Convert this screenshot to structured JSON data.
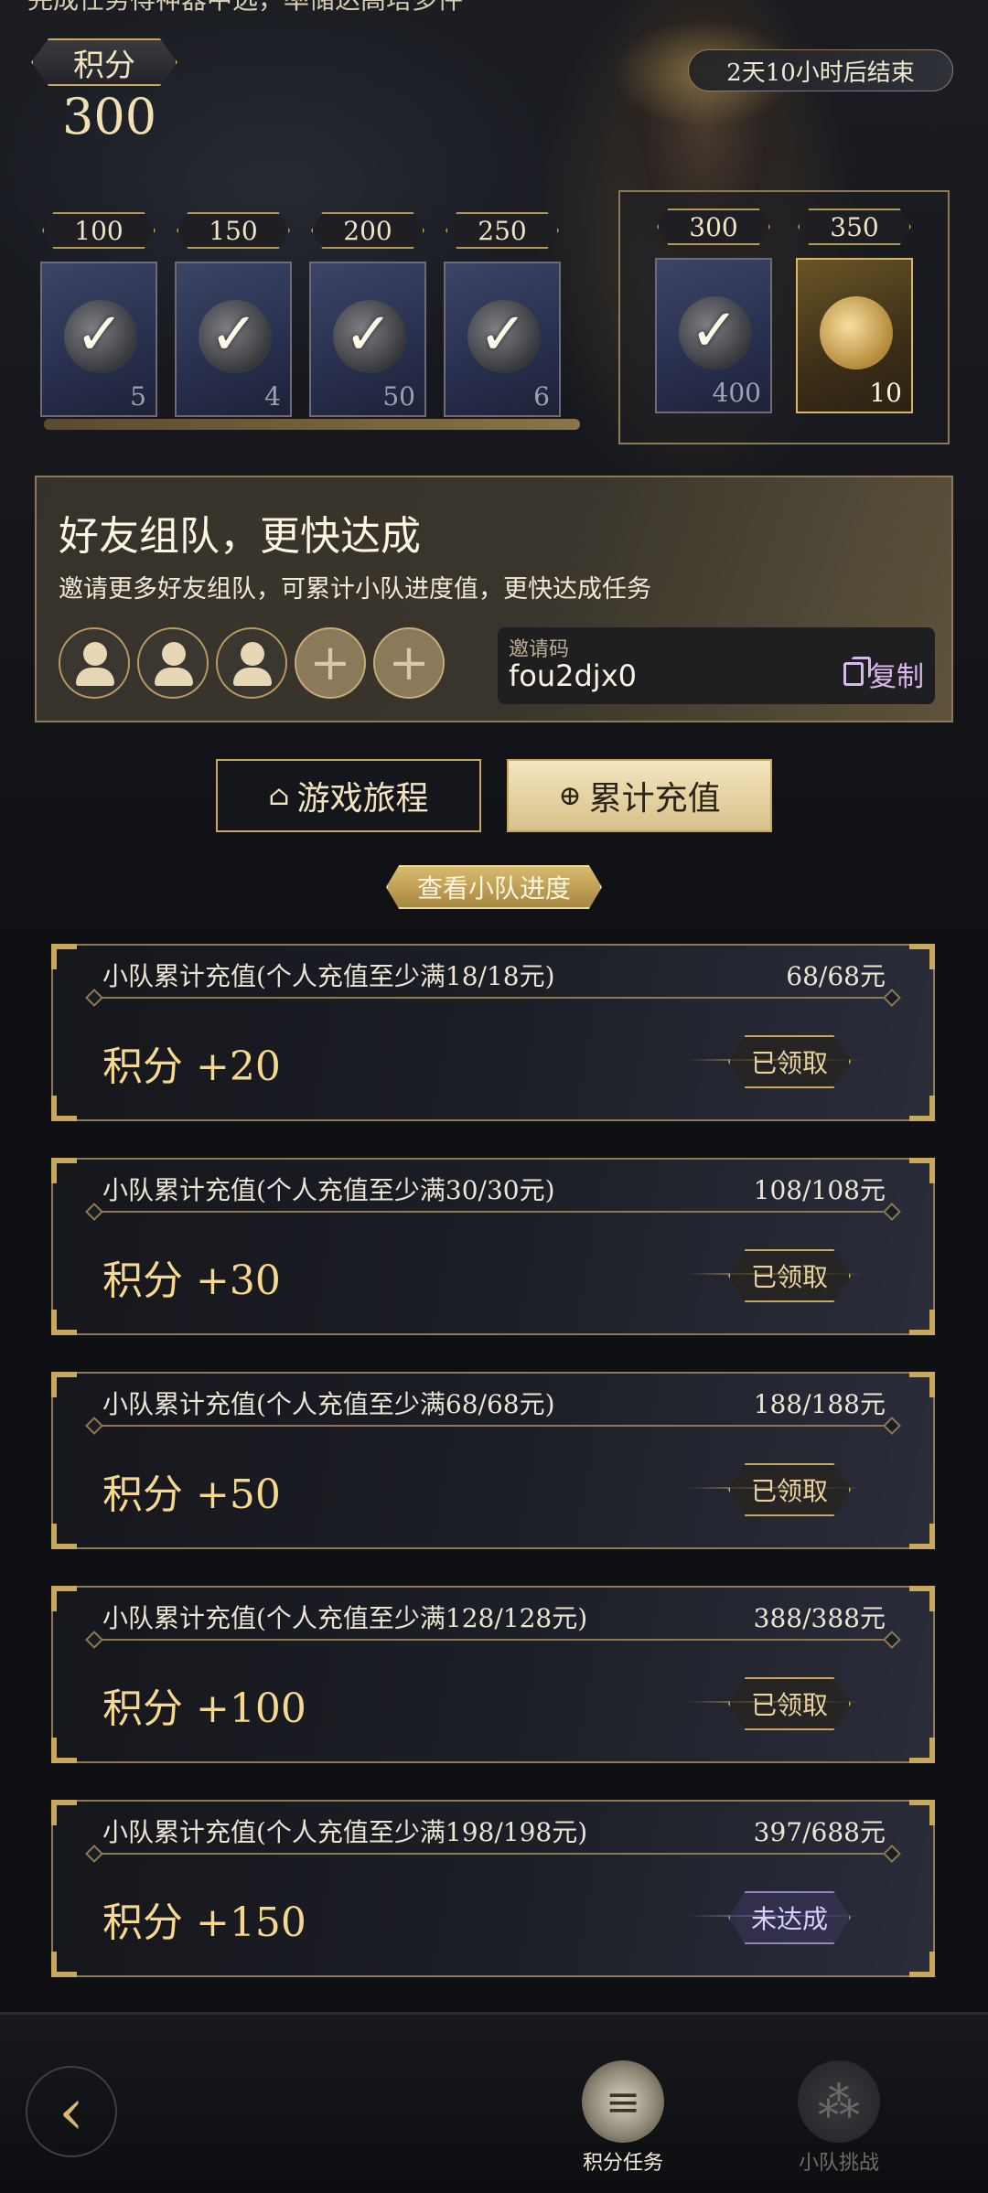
{
  "header": {
    "top_cut_text": "完成任务得神器中选，率储达高塔多件",
    "points_label": "积分",
    "points_value": "300",
    "timer": "2天10小时后结束"
  },
  "rewards": [
    {
      "cost": "100",
      "qty": "5",
      "claimed": true
    },
    {
      "cost": "150",
      "qty": "4",
      "claimed": true
    },
    {
      "cost": "200",
      "qty": "50",
      "claimed": true
    },
    {
      "cost": "250",
      "qty": "6",
      "claimed": true
    },
    {
      "cost": "300",
      "qty": "400",
      "claimed": true
    },
    {
      "cost": "350",
      "qty": "10",
      "claimed": false
    }
  ],
  "reward_progress": 1.0,
  "team": {
    "title": "好友组队，更快达成",
    "subtitle": "邀请更多好友组队，可累计小队进度值，更快达成任务",
    "invite_label": "邀请码",
    "invite_code": "fou2djx0",
    "copy_label": "复制"
  },
  "tabs": {
    "journey": "游戏旅程",
    "recharge": "累计充值"
  },
  "team_progress_button": "查看小队进度",
  "tasks": [
    {
      "desc": "小队累计充值(个人充值至少满18/18元)",
      "amount": "68/68元",
      "reward": "积分 +20",
      "state": "已领取",
      "done": true
    },
    {
      "desc": "小队累计充值(个人充值至少满30/30元)",
      "amount": "108/108元",
      "reward": "积分 +30",
      "state": "已领取",
      "done": true
    },
    {
      "desc": "小队累计充值(个人充值至少满68/68元)",
      "amount": "188/188元",
      "reward": "积分 +50",
      "state": "已领取",
      "done": true
    },
    {
      "desc": "小队累计充值(个人充值至少满128/128元)",
      "amount": "388/388元",
      "reward": "积分 +100",
      "state": "已领取",
      "done": true
    },
    {
      "desc": "小队累计充值(个人充值至少满198/198元)",
      "amount": "397/688元",
      "reward": "积分 +150",
      "state": "未达成",
      "done": false
    }
  ],
  "bottom_nav": {
    "points_tasks": "积分任务",
    "team_challenge": "小队挑战"
  },
  "colors": {
    "gold": "#c9a85c",
    "reward_text": "#f6d98c",
    "pending": "#8f88b8"
  }
}
